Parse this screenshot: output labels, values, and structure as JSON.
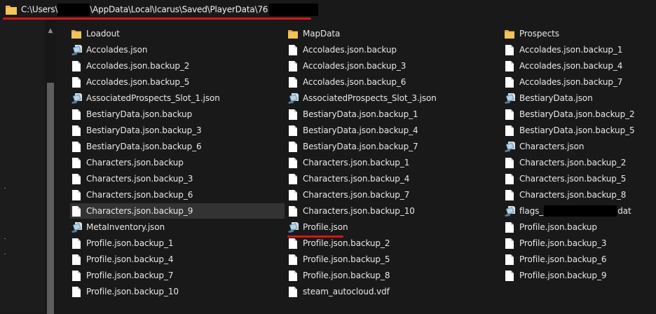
{
  "address": {
    "segments": [
      "C:\\Users\\",
      "\\AppData\\Local\\Icarus\\Saved\\PlayerData\\76"
    ]
  },
  "colors": {
    "folder": "#e8b24a",
    "highlight": "#d51717",
    "selection": "#333333"
  },
  "columns": [
    [
      {
        "name": "Loadout",
        "icon": "folder-icon"
      },
      {
        "name": "Accolades.json",
        "icon": "json-file-icon"
      },
      {
        "name": "Accolades.json.backup_2",
        "icon": "file-icon"
      },
      {
        "name": "Accolades.json.backup_5",
        "icon": "file-icon"
      },
      {
        "name": "AssociatedProspects_Slot_1.json",
        "icon": "json-file-icon"
      },
      {
        "name": "BestiaryData.json.backup",
        "icon": "file-icon"
      },
      {
        "name": "BestiaryData.json.backup_3",
        "icon": "file-icon"
      },
      {
        "name": "BestiaryData.json.backup_6",
        "icon": "file-icon"
      },
      {
        "name": "Characters.json.backup",
        "icon": "file-icon"
      },
      {
        "name": "Characters.json.backup_3",
        "icon": "file-icon"
      },
      {
        "name": "Characters.json.backup_6",
        "icon": "file-icon"
      },
      {
        "name": "Characters.json.backup_9",
        "icon": "file-icon",
        "selected": true
      },
      {
        "name": "MetaInventory.json",
        "icon": "json-file-icon"
      },
      {
        "name": "Profile.json.backup_1",
        "icon": "file-icon"
      },
      {
        "name": "Profile.json.backup_4",
        "icon": "file-icon"
      },
      {
        "name": "Profile.json.backup_7",
        "icon": "file-icon"
      },
      {
        "name": "Profile.json.backup_10",
        "icon": "file-icon"
      }
    ],
    [
      {
        "name": "MapData",
        "icon": "folder-icon"
      },
      {
        "name": "Accolades.json.backup",
        "icon": "file-icon"
      },
      {
        "name": "Accolades.json.backup_3",
        "icon": "file-icon"
      },
      {
        "name": "Accolades.json.backup_6",
        "icon": "file-icon"
      },
      {
        "name": "AssociatedProspects_Slot_3.json",
        "icon": "json-file-icon"
      },
      {
        "name": "BestiaryData.json.backup_1",
        "icon": "file-icon"
      },
      {
        "name": "BestiaryData.json.backup_4",
        "icon": "file-icon"
      },
      {
        "name": "BestiaryData.json.backup_7",
        "icon": "file-icon"
      },
      {
        "name": "Characters.json.backup_1",
        "icon": "file-icon"
      },
      {
        "name": "Characters.json.backup_4",
        "icon": "file-icon"
      },
      {
        "name": "Characters.json.backup_7",
        "icon": "file-icon"
      },
      {
        "name": "Characters.json.backup_10",
        "icon": "file-icon"
      },
      {
        "name": "Profile.json",
        "icon": "json-file-icon"
      },
      {
        "name": "Profile.json.backup_2",
        "icon": "file-icon"
      },
      {
        "name": "Profile.json.backup_5",
        "icon": "file-icon"
      },
      {
        "name": "Profile.json.backup_8",
        "icon": "file-icon"
      },
      {
        "name": "steam_autocloud.vdf",
        "icon": "file-icon"
      }
    ],
    [
      {
        "name": "Prospects",
        "icon": "folder-icon"
      },
      {
        "name": "Accolades.json.backup_1",
        "icon": "file-icon"
      },
      {
        "name": "Accolades.json.backup_4",
        "icon": "file-icon"
      },
      {
        "name": "Accolades.json.backup_7",
        "icon": "file-icon"
      },
      {
        "name": "BestiaryData.json",
        "icon": "json-file-icon"
      },
      {
        "name": "BestiaryData.json.backup_2",
        "icon": "file-icon"
      },
      {
        "name": "BestiaryData.json.backup_5",
        "icon": "file-icon"
      },
      {
        "name": "Characters.json",
        "icon": "json-file-icon"
      },
      {
        "name": "Characters.json.backup_2",
        "icon": "file-icon"
      },
      {
        "name": "Characters.json.backup_5",
        "icon": "file-icon"
      },
      {
        "name": "Characters.json.backup_8",
        "icon": "file-icon"
      },
      {
        "name": "flags_",
        "suffix": "dat",
        "redacted": true,
        "icon": "json-file-icon"
      },
      {
        "name": "Profile.json.backup",
        "icon": "file-icon"
      },
      {
        "name": "Profile.json.backup_3",
        "icon": "file-icon"
      },
      {
        "name": "Profile.json.backup_6",
        "icon": "file-icon"
      },
      {
        "name": "Profile.json.backup_9",
        "icon": "file-icon"
      }
    ]
  ]
}
